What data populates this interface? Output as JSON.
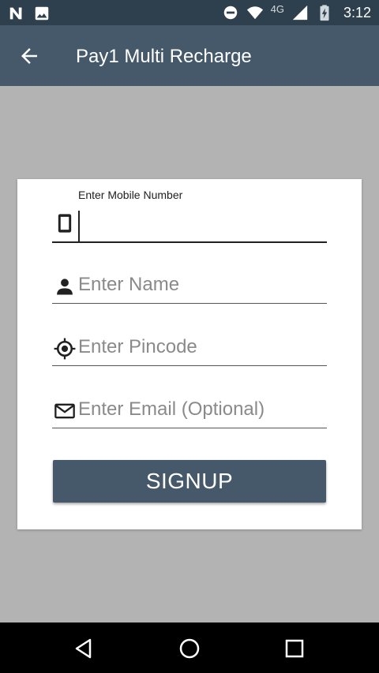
{
  "status_bar": {
    "network_type": "4G",
    "time": "3:12"
  },
  "app_bar": {
    "title": "Pay1 Multi Recharge"
  },
  "form": {
    "mobile": {
      "label": "Enter Mobile Number",
      "value": "",
      "icon": "phone-icon"
    },
    "name": {
      "placeholder": "Enter Name",
      "icon": "person-icon"
    },
    "pincode": {
      "placeholder": "Enter Pincode",
      "icon": "location-icon"
    },
    "email": {
      "placeholder": "Enter Email (Optional)",
      "icon": "email-icon"
    },
    "signup_label": "SIGNUP"
  },
  "colors": {
    "status_bar": "#2e3f4d",
    "app_bar": "#46596b",
    "background": "#b3b3b3",
    "button": "#46596b"
  }
}
